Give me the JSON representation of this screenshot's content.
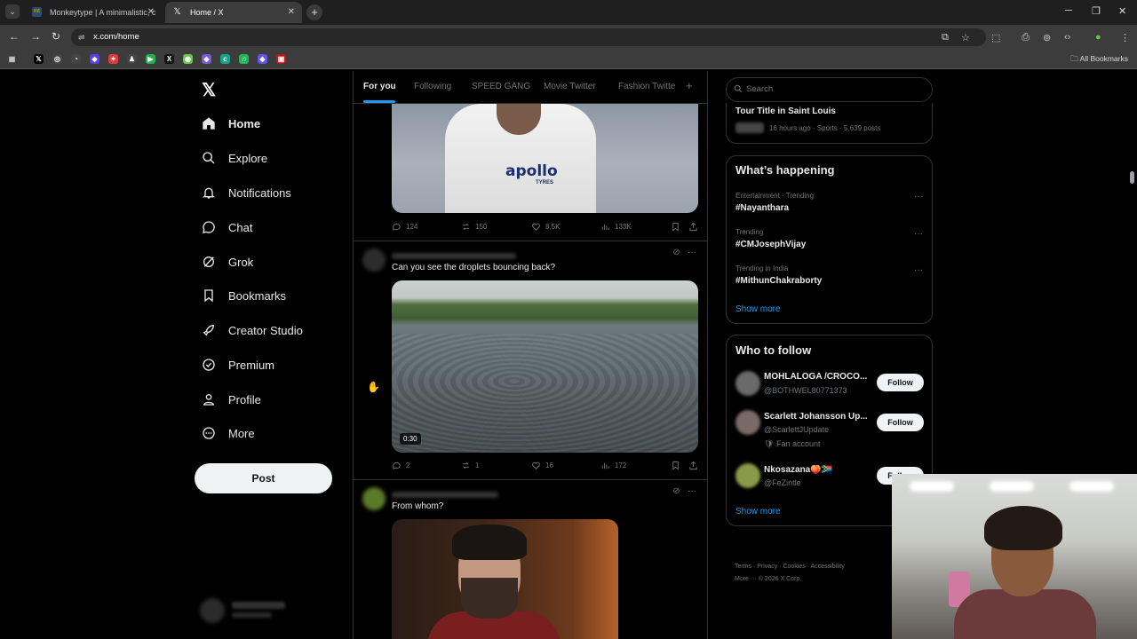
{
  "browser": {
    "tabs": [
      {
        "title": "Monkeytype | A minimalistic, c",
        "favicon": "mt"
      },
      {
        "title": "Home / X",
        "favicon": "𝕏"
      }
    ],
    "url": "x.com/home",
    "bookmarks_label": "All Bookmarks",
    "bookmark_icons": [
      {
        "glyph": "𝕏",
        "color": "#000000"
      },
      {
        "glyph": "◎",
        "color": "#444444"
      },
      {
        "glyph": "◔",
        "color": "#444444"
      },
      {
        "glyph": "◆",
        "color": "#5b3df5"
      },
      {
        "glyph": "✦",
        "color": "#e03a3a"
      },
      {
        "glyph": "♟",
        "color": "#444444"
      },
      {
        "glyph": "▶",
        "color": "#20b24a"
      },
      {
        "glyph": "X",
        "color": "#111111"
      },
      {
        "glyph": "◉",
        "color": "#6cc24a"
      },
      {
        "glyph": "◈",
        "color": "#7b59d8"
      },
      {
        "glyph": "c",
        "color": "#14a38b"
      },
      {
        "glyph": "♫",
        "color": "#1db954"
      },
      {
        "glyph": "◆",
        "color": "#6254e8"
      },
      {
        "glyph": "▣",
        "color": "#c4161c"
      }
    ]
  },
  "nav": {
    "logo": "𝕏",
    "items": [
      {
        "label": "Home",
        "icon": "home-icon"
      },
      {
        "label": "Explore",
        "icon": "search-icon"
      },
      {
        "label": "Notifications",
        "icon": "bell-icon"
      },
      {
        "label": "Chat",
        "icon": "chat-icon"
      },
      {
        "label": "Grok",
        "icon": "grok-icon"
      },
      {
        "label": "Bookmarks",
        "icon": "bookmark-icon"
      },
      {
        "label": "Creator Studio",
        "icon": "rocket-icon"
      },
      {
        "label": "Premium",
        "icon": "premium-icon"
      },
      {
        "label": "Profile",
        "icon": "person-icon"
      },
      {
        "label": "More",
        "icon": "more-circle-icon"
      }
    ],
    "post_button": "Post"
  },
  "feed": {
    "tabs": [
      "For you",
      "Following",
      "SPEED GANG",
      "Movie Twitter",
      "Fashion Twitte"
    ],
    "posts": [
      {
        "media_text": "apollo",
        "media_subtext": "TYRES",
        "replies": "124",
        "reposts": "150",
        "likes": "8.5K",
        "views": "133K"
      },
      {
        "text": "Can you see the droplets bouncing back?",
        "duration": "0:30",
        "replies": "2",
        "reposts": "1",
        "likes": "16",
        "views": "172"
      },
      {
        "text": "From whom?"
      }
    ]
  },
  "sidebar": {
    "search_placeholder": "Search",
    "top_item": {
      "title": "Tour Title in Saint Louis",
      "meta": "16 hours ago · Sports · 5,639 posts"
    },
    "happening": {
      "title": "What’s happening",
      "trends": [
        {
          "context": "Entertainment · Trending",
          "tag": "#Nayanthara"
        },
        {
          "context": "Trending",
          "tag": "#CMJosephVijay"
        },
        {
          "context": "Trending in India",
          "tag": "#MithunChakraborty"
        }
      ],
      "show_more": "Show more"
    },
    "who_to_follow": {
      "title": "Who to follow",
      "accounts": [
        {
          "name": "MOHLALOGA /CROCO...",
          "handle": "@BOTHWEL80771373",
          "extra": ""
        },
        {
          "name": "Scarlett Johansson Up...",
          "handle": "@ScarlettJUpdate",
          "extra": "Fan account"
        },
        {
          "name": "Nkosazana🍑🇿🇦",
          "handle": "@FeZintle",
          "extra": ""
        }
      ],
      "follow_label": "Follow",
      "show_more": "Show more"
    },
    "footer": {
      "line1": [
        "Terms",
        "Privacy",
        "Cookies",
        "Accessibility"
      ],
      "line2": "More ···  © 2026 X Corp."
    }
  }
}
